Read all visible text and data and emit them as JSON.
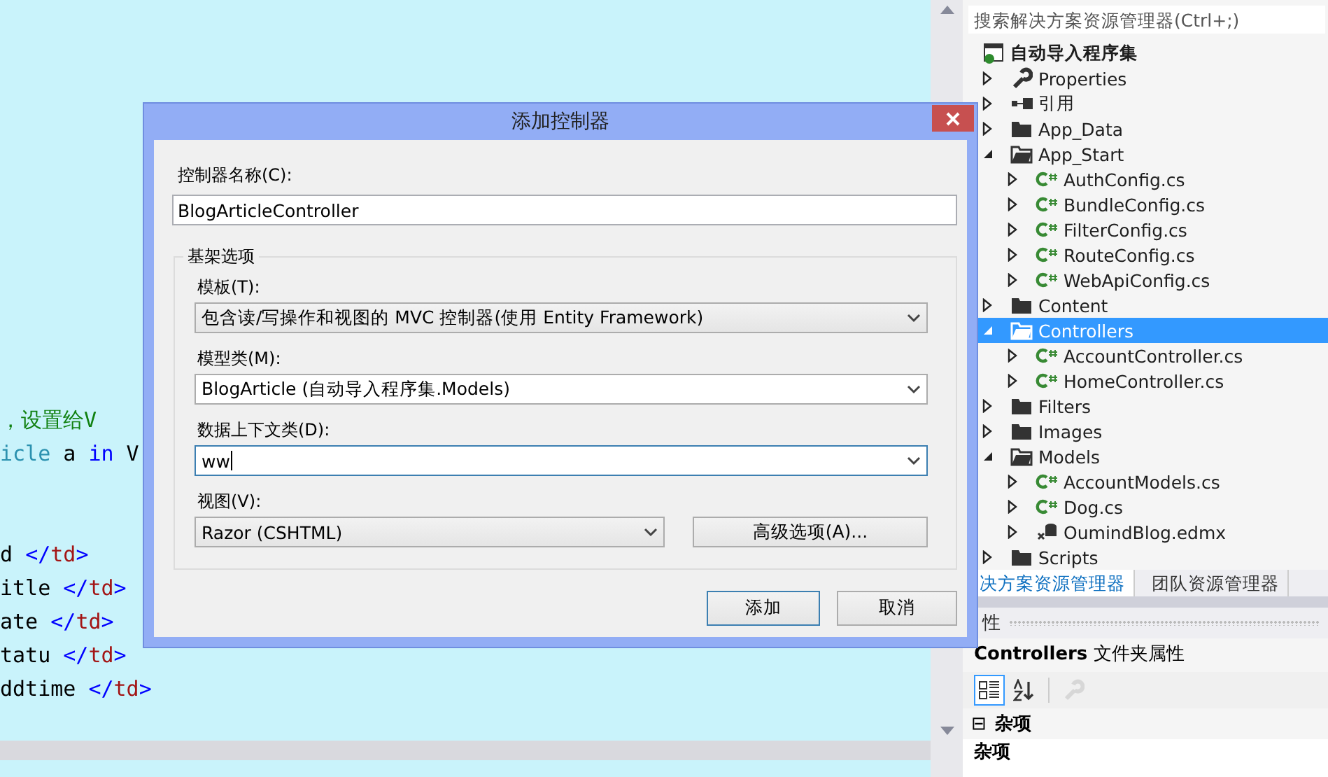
{
  "editor": {
    "lines_top": [
      [
        {
          "text": "，设置给V",
          "kind": "comment"
        }
      ],
      [
        {
          "text": "icle",
          "kind": "type"
        },
        {
          "text": " a ",
          "kind": "plain"
        },
        {
          "text": "in",
          "kind": "keyword"
        },
        {
          "text": " V",
          "kind": "plain"
        }
      ]
    ],
    "lines_bottom": [
      [
        {
          "text": "d ",
          "kind": "plain"
        },
        {
          "text": "</",
          "kind": "bracket"
        },
        {
          "text": "td",
          "kind": "tag"
        },
        {
          "text": ">",
          "kind": "bracket"
        }
      ],
      [
        {
          "text": "itle ",
          "kind": "plain"
        },
        {
          "text": "</",
          "kind": "bracket"
        },
        {
          "text": "td",
          "kind": "tag"
        },
        {
          "text": ">",
          "kind": "bracket"
        }
      ],
      [
        {
          "text": "ate ",
          "kind": "plain"
        },
        {
          "text": "</",
          "kind": "bracket"
        },
        {
          "text": "td",
          "kind": "tag"
        },
        {
          "text": ">",
          "kind": "bracket"
        }
      ],
      [
        {
          "text": "tatu ",
          "kind": "plain"
        },
        {
          "text": "</",
          "kind": "bracket"
        },
        {
          "text": "td",
          "kind": "tag"
        },
        {
          "text": ">",
          "kind": "bracket"
        }
      ],
      [
        {
          "text": "ddtime ",
          "kind": "plain"
        },
        {
          "text": "</",
          "kind": "bracket"
        },
        {
          "text": "td",
          "kind": "tag"
        },
        {
          "text": ">",
          "kind": "bracket"
        }
      ]
    ]
  },
  "dialog": {
    "title": "添加控制器",
    "name_label": "控制器名称(C):",
    "name_value": "BlogArticleController",
    "group": {
      "legend": "基架选项",
      "fields": [
        {
          "label": "模板(T):",
          "value": "包含读/写操作和视图的 MVC 控制器(使用 Entity Framework)",
          "kind": "combo",
          "focused": false
        },
        {
          "label": "模型类(M):",
          "value": "BlogArticle (自动导入程序集.Models)",
          "kind": "editable",
          "focused": false
        },
        {
          "label": "数据上下文类(D):",
          "value": "ww",
          "kind": "editable",
          "focused": true
        },
        {
          "label": "视图(V):",
          "value": "Razor (CSHTML)",
          "kind": "combo",
          "focused": false
        }
      ],
      "advanced_button": "高级选项(A)..."
    },
    "buttons": [
      {
        "label": "添加",
        "default": true
      },
      {
        "label": "取消",
        "default": false
      }
    ]
  },
  "solution_explorer": {
    "search": {
      "placeholder": "搜索解决方案资源管理器(Ctrl+;)"
    },
    "tree": {
      "label": "自动导入程序集",
      "kind": "project",
      "selected": false,
      "children": [
        {
          "label": "Properties",
          "kind": "wrench",
          "expanded": false,
          "selected": false
        },
        {
          "label": "引用",
          "kind": "reference",
          "expanded": false,
          "selected": false
        },
        {
          "label": "App_Data",
          "kind": "folder",
          "expanded": false,
          "selected": false
        },
        {
          "label": "App_Start",
          "kind": "folder",
          "expanded": true,
          "selected": false,
          "children": [
            {
              "label": "AuthConfig.cs",
              "kind": "cs",
              "expanded": false,
              "selected": false
            },
            {
              "label": "BundleConfig.cs",
              "kind": "cs",
              "expanded": false,
              "selected": false
            },
            {
              "label": "FilterConfig.cs",
              "kind": "cs",
              "expanded": false,
              "selected": false
            },
            {
              "label": "RouteConfig.cs",
              "kind": "cs",
              "expanded": false,
              "selected": false
            },
            {
              "label": "WebApiConfig.cs",
              "kind": "cs",
              "expanded": false,
              "selected": false
            }
          ]
        },
        {
          "label": "Content",
          "kind": "folder",
          "expanded": false,
          "selected": false
        },
        {
          "label": "Controllers",
          "kind": "folder",
          "expanded": true,
          "selected": true,
          "children": [
            {
              "label": "AccountController.cs",
              "kind": "cs",
              "expanded": false,
              "selected": false
            },
            {
              "label": "HomeController.cs",
              "kind": "cs",
              "expanded": false,
              "selected": false
            }
          ]
        },
        {
          "label": "Filters",
          "kind": "folder",
          "expanded": false,
          "selected": false
        },
        {
          "label": "Images",
          "kind": "folder",
          "expanded": false,
          "selected": false
        },
        {
          "label": "Models",
          "kind": "folder",
          "expanded": true,
          "selected": false,
          "children": [
            {
              "label": "AccountModels.cs",
              "kind": "cs",
              "expanded": false,
              "selected": false
            },
            {
              "label": "Dog.cs",
              "kind": "cs",
              "expanded": false,
              "selected": false
            },
            {
              "label": "OumindBlog.edmx",
              "kind": "edmx",
              "expanded": false,
              "selected": false
            }
          ]
        },
        {
          "label": "Scripts",
          "kind": "folder",
          "expanded": false,
          "selected": false
        }
      ]
    },
    "tabs": [
      {
        "label": "决方案资源管理器",
        "selected": true
      },
      {
        "label": "团队资源管理器",
        "selected": false
      }
    ]
  },
  "properties": {
    "title": "性",
    "object": "**Controllers** 文件夹属性",
    "toolbar": [
      {
        "kind": "categorized",
        "selected": true,
        "disabled": false
      },
      {
        "kind": "alphabetical",
        "selected": false,
        "disabled": false
      },
      {
        "kind": "wrench",
        "selected": false,
        "disabled": true
      }
    ],
    "category": {
      "toggle": "⊟",
      "label": "杂项"
    },
    "item": "杂项"
  }
}
